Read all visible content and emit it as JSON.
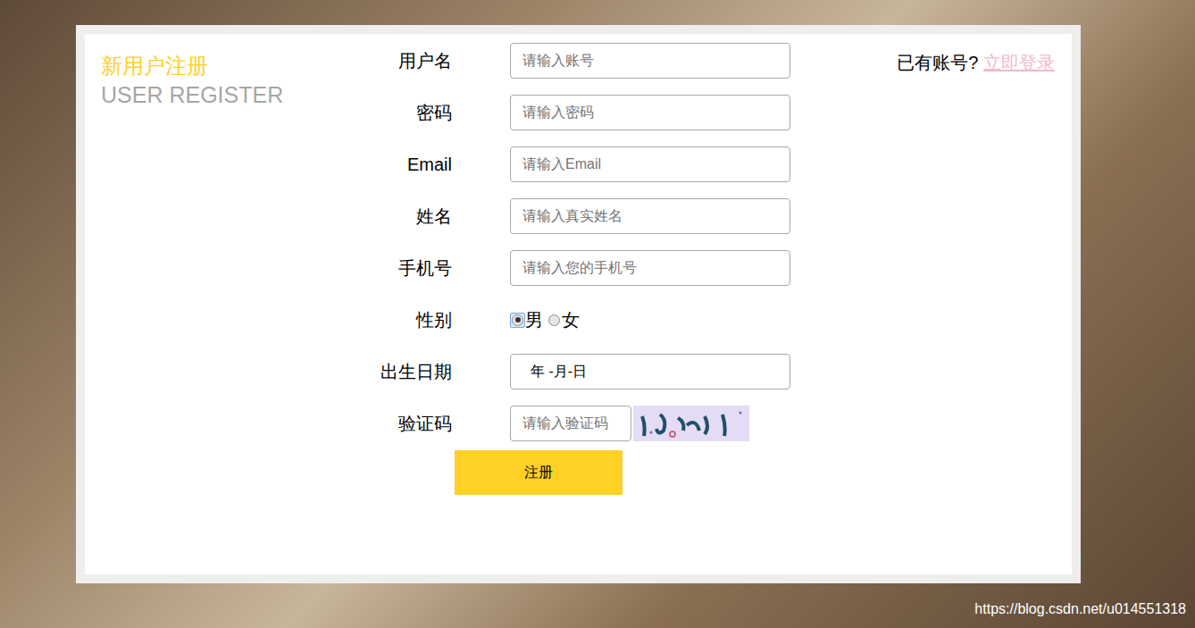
{
  "title": "新用户注册",
  "subtitle": "USER REGISTER",
  "fields": [
    {
      "label": "用户名",
      "kind": "text",
      "placeholder": "请输入账号"
    },
    {
      "label": "密码",
      "kind": "text",
      "placeholder": "请输入密码"
    },
    {
      "label": "Email",
      "kind": "text",
      "placeholder": "请输入Email"
    },
    {
      "label": "姓名",
      "kind": "text",
      "placeholder": "请输入真实姓名"
    },
    {
      "label": "手机号",
      "kind": "text",
      "placeholder": "请输入您的手机号"
    },
    {
      "label": "性别",
      "kind": "radio",
      "options": [
        {
          "label": "男",
          "selected": true
        },
        {
          "label": "女",
          "selected": false
        }
      ]
    },
    {
      "label": "出生日期",
      "kind": "date",
      "value": "年 -月-日"
    },
    {
      "label": "验证码",
      "kind": "captcha",
      "placeholder": "请输入验证码"
    }
  ],
  "submit": "注册",
  "login_prompt": "已有账号?",
  "login_link": "立即登录",
  "watermark": "https://blog.csdn.net/u014551318"
}
